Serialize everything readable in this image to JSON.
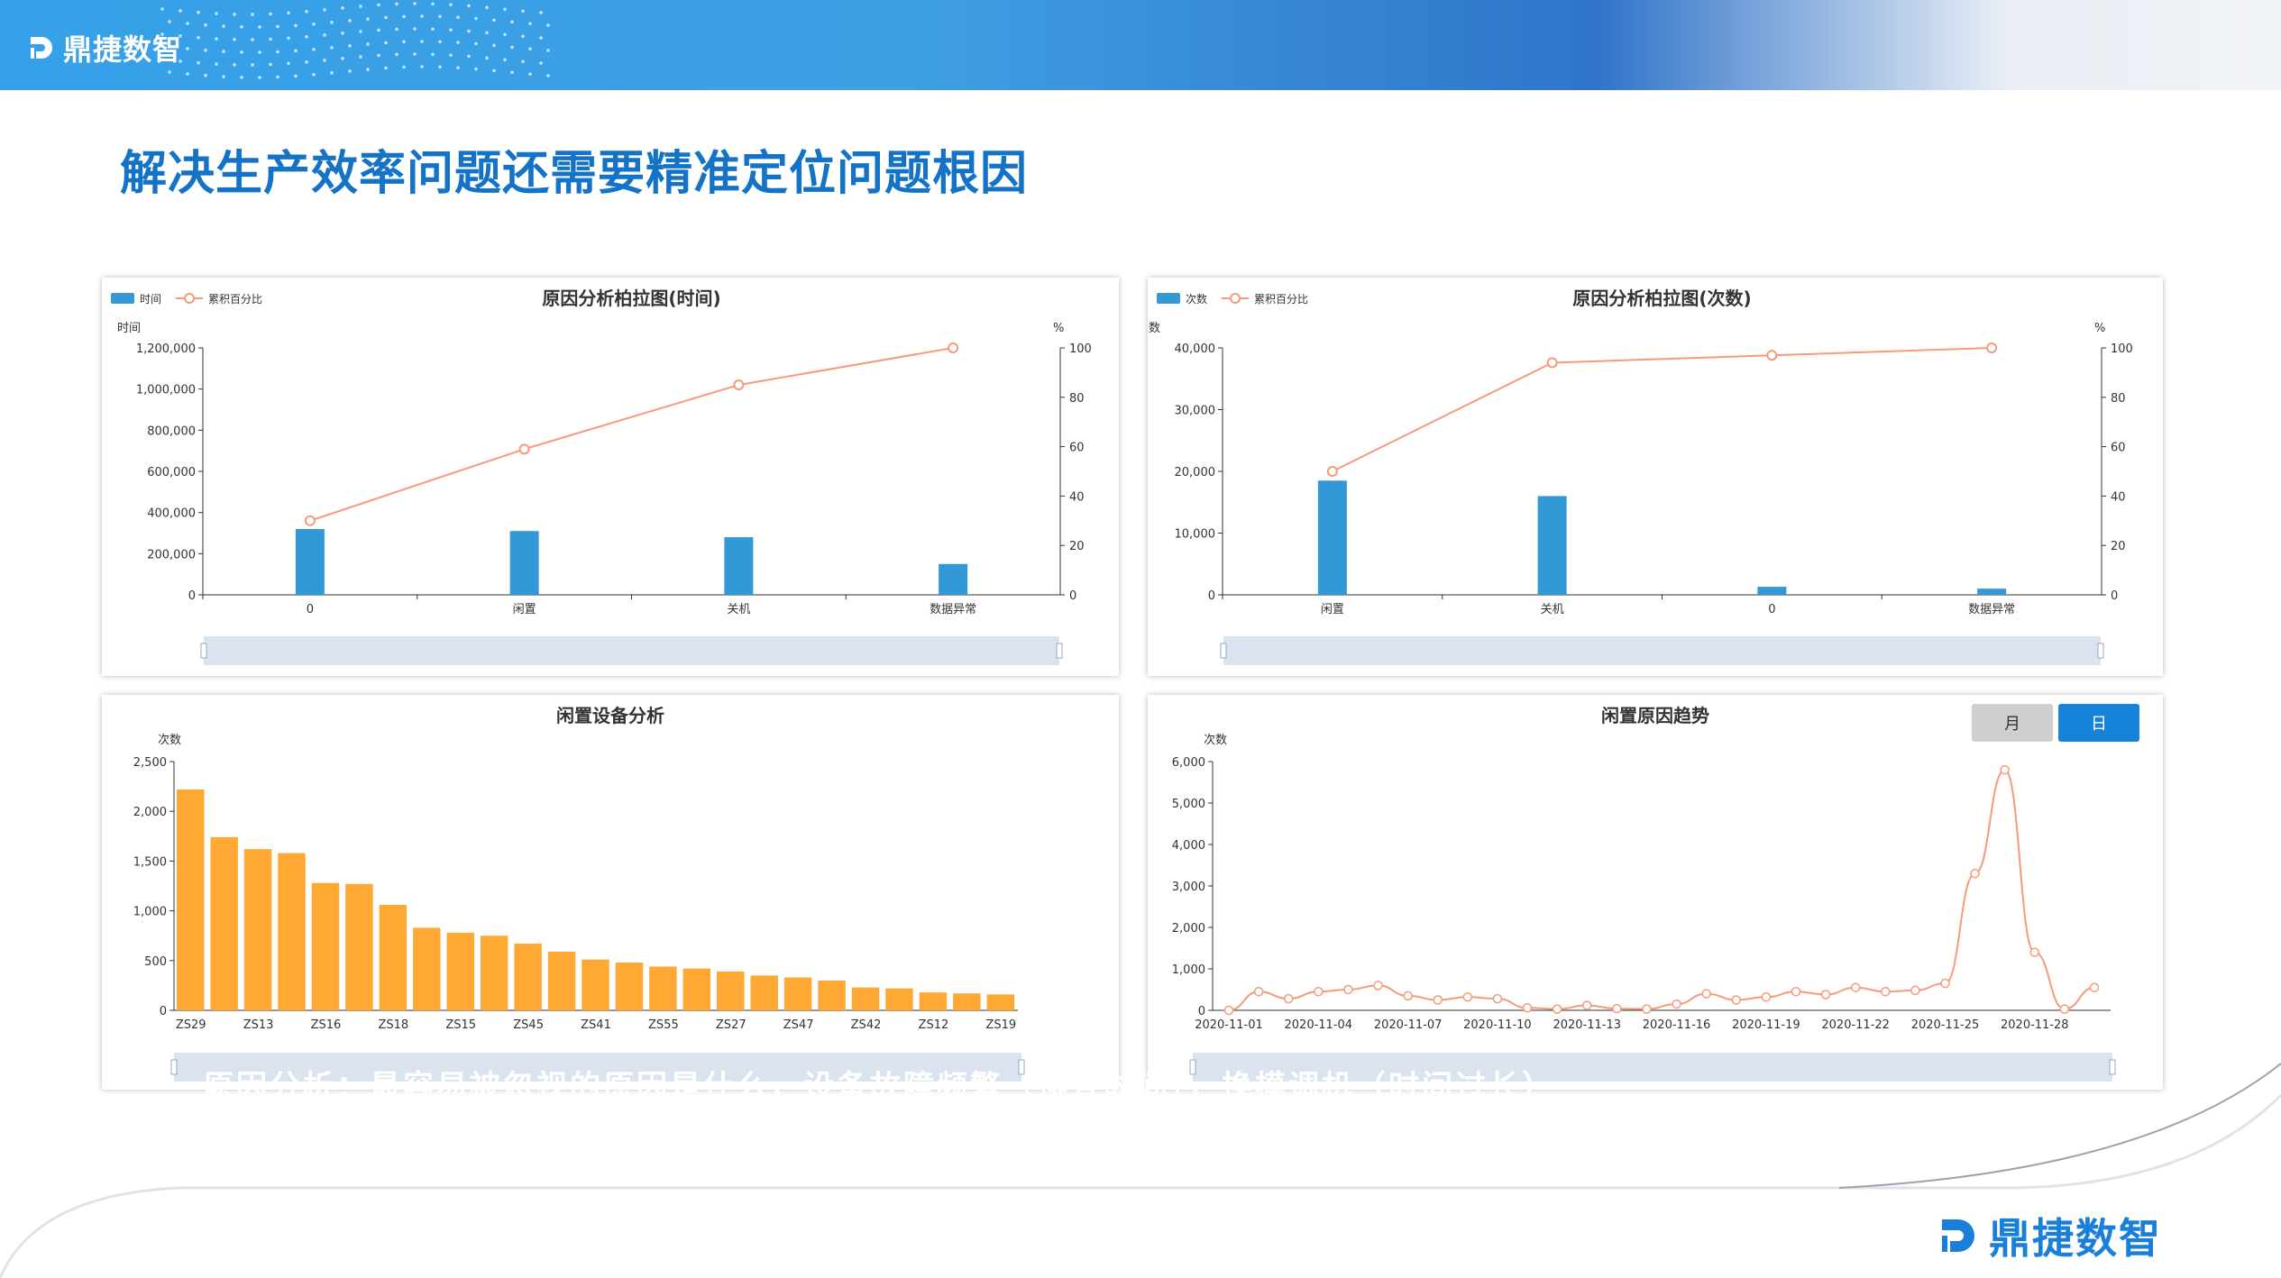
{
  "brand": {
    "name": "鼎捷数智",
    "accent": "#1a7fd8"
  },
  "page_title": "解决生产效率问题还需要精准定位问题根因",
  "overlay_text": "原因分析：最容易被忽视的原因是什么，设备故障频繁（排查时间），换模调机（时间过长）",
  "colors": {
    "bar_blue": "#3399d6",
    "line_orange": "#f59a7b",
    "bar_orange": "#ffa833",
    "title_blue": "#1473c6"
  },
  "chart_data": [
    {
      "type": "bar",
      "title": "原因分析柏拉图(时间)",
      "legend": [
        "时间",
        "累积百分比"
      ],
      "legend_placement": "top-left",
      "ylabel": "时间",
      "y2label": "%",
      "categories": [
        "0",
        "闲置",
        "关机",
        "数据异常"
      ],
      "yticks": [
        "0",
        "200,000",
        "400,000",
        "600,000",
        "800,000",
        "1,000,000",
        "1,200,000"
      ],
      "y2ticks": [
        "0",
        "20",
        "40",
        "60",
        "80",
        "100"
      ],
      "ylim": [
        0,
        1200000
      ],
      "y2lim": [
        0,
        100
      ],
      "series": [
        {
          "name": "时间",
          "type": "bar",
          "values": [
            320000,
            310000,
            280000,
            150000
          ]
        },
        {
          "name": "累积百分比",
          "type": "line",
          "values": [
            30,
            59,
            85,
            100
          ]
        }
      ]
    },
    {
      "type": "bar",
      "title": "原因分析柏拉图(次数)",
      "legend": [
        "次数",
        "累积百分比"
      ],
      "legend_placement": "top-left",
      "ylabel": "次数",
      "y2label": "%",
      "categories": [
        "闲置",
        "关机",
        "0",
        "数据异常"
      ],
      "yticks": [
        "0",
        "10,000",
        "20,000",
        "30,000",
        "40,000"
      ],
      "y2ticks": [
        "0",
        "20",
        "40",
        "60",
        "80",
        "100"
      ],
      "ylim": [
        0,
        40000
      ],
      "y2lim": [
        0,
        100
      ],
      "series": [
        {
          "name": "次数",
          "type": "bar",
          "values": [
            18500,
            16000,
            1300,
            1000
          ]
        },
        {
          "name": "累积百分比",
          "type": "line",
          "values": [
            50,
            94,
            97,
            100
          ]
        }
      ]
    },
    {
      "type": "bar",
      "title": "闲置设备分析",
      "ylabel": "次数",
      "yticks": [
        "0",
        "500",
        "1,000",
        "1,500",
        "2,000",
        "2,500"
      ],
      "ylim": [
        0,
        2500
      ],
      "categories": [
        "ZS29",
        "ZS13",
        "ZS16",
        "ZS18",
        "ZS15",
        "ZS45",
        "ZS41",
        "ZS55",
        "ZS27",
        "ZS47",
        "ZS42",
        "ZS12",
        "ZS19"
      ],
      "tick_labels": [
        "ZS29",
        "ZS13",
        "ZS16",
        "ZS18",
        "ZS15",
        "ZS45",
        "ZS41",
        "ZS55",
        "ZS27",
        "ZS47",
        "ZS42",
        "ZS12",
        "ZS19"
      ],
      "values": [
        2220,
        1740,
        1620,
        1580,
        1280,
        1270,
        1060,
        830,
        780,
        750,
        670,
        590,
        510,
        480,
        440,
        420,
        390,
        350,
        330,
        300,
        230,
        220,
        180,
        170,
        160
      ]
    },
    {
      "type": "line",
      "title": "闲置原因趋势",
      "toggle": [
        "月",
        "日"
      ],
      "ylabel": "次数",
      "yticks": [
        "0",
        "1,000",
        "2,000",
        "3,000",
        "4,000",
        "5,000",
        "6,000"
      ],
      "ylim": [
        0,
        6000
      ],
      "tick_labels": [
        "2020-11-01",
        "2020-11-04",
        "2020-11-07",
        "2020-11-10",
        "2020-11-13",
        "2020-11-16",
        "2020-11-19",
        "2020-11-22",
        "2020-11-25",
        "2020-11-28"
      ],
      "values": [
        0,
        450,
        280,
        450,
        500,
        600,
        350,
        250,
        320,
        280,
        60,
        30,
        120,
        40,
        30,
        150,
        400,
        250,
        320,
        450,
        380,
        550,
        450,
        480,
        650,
        3300,
        5800,
        1400,
        30,
        550
      ]
    }
  ]
}
